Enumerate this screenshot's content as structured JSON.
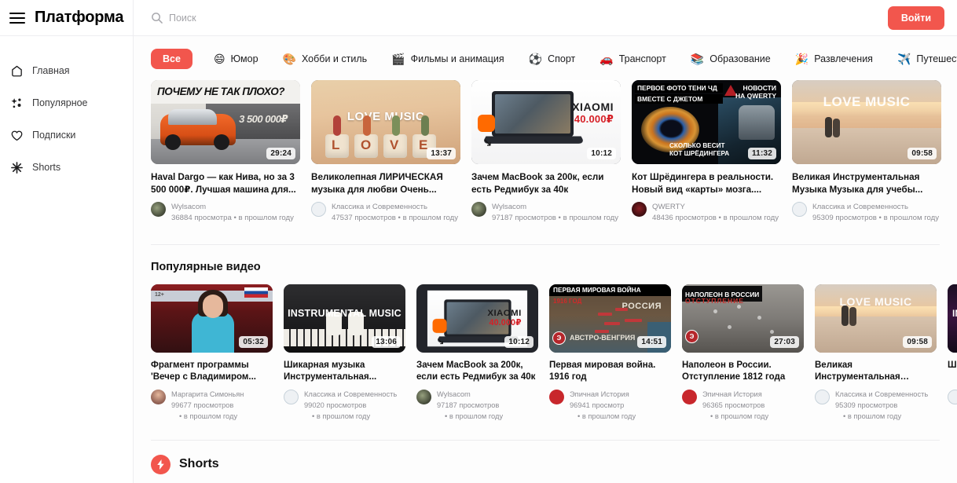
{
  "header": {
    "brand": "Платформа",
    "menu_icon": "hamburger-icon",
    "search_placeholder": "Поиск",
    "search_value": "",
    "search_icon": "search-icon",
    "login_label": "Войти",
    "accent_color": "#f2564d"
  },
  "sidebar": {
    "items": [
      {
        "label": "Главная",
        "icon": "home-icon"
      },
      {
        "label": "Популярное",
        "icon": "sparkle-icon"
      },
      {
        "label": "Подписки",
        "icon": "heart-icon"
      },
      {
        "label": "Shorts",
        "icon": "asterisk-icon"
      }
    ]
  },
  "categories": [
    {
      "label": "Все",
      "emoji": "",
      "active": true
    },
    {
      "label": "Юмор",
      "emoji": "😄",
      "active": false
    },
    {
      "label": "Хобби и стиль",
      "emoji": "🎨",
      "active": false
    },
    {
      "label": "Фильмы и анимация",
      "emoji": "🎬",
      "active": false
    },
    {
      "label": "Спорт",
      "emoji": "⚽",
      "active": false
    },
    {
      "label": "Транспорт",
      "emoji": "🚗",
      "active": false
    },
    {
      "label": "Образование",
      "emoji": "📚",
      "active": false
    },
    {
      "label": "Развлечения",
      "emoji": "🎉",
      "active": false
    },
    {
      "label": "Путешествия",
      "emoji": "✈️",
      "active": false
    }
  ],
  "feed": {
    "videos": [
      {
        "title": "Haval Dargo — как Нива, но за 3 500 000₽. Лучшая машина для...",
        "channel": "Wylsacom",
        "views": "36884 просмотра",
        "when": "в прошлом году",
        "stats": "36884 просмотра • в прошлом году",
        "duration": "29:24",
        "thumb_text": "ПОЧЕМУ НЕ ТАК ПЛОХО?",
        "thumb_price": "3 500 000₽"
      },
      {
        "title": "Великолепная ЛИРИЧЕСКАЯ музыка для любви Очень...",
        "channel": "Классика и Современность",
        "views": "47537 просмотров",
        "when": "в прошлом году",
        "stats": "47537 просмотров • в прошлом году",
        "duration": "13:37",
        "thumb_text": "LOVE MUSIC",
        "thumb_price": ""
      },
      {
        "title": "Зачем MacBook за 200к, если есть Редмибук за 40к",
        "channel": "Wylsacom",
        "views": "97187 просмотров",
        "when": "в прошлом году",
        "stats": "97187 просмотров • в прошлом году",
        "duration": "10:12",
        "thumb_text": "XIAOMI",
        "thumb_price": "40.000₽"
      },
      {
        "title": "Кот Шрёдингера в реальности. Новый вид «карты» мозга....",
        "channel": "QWERTY",
        "views": "48436 просмотров",
        "when": "в прошлом году",
        "stats": "48436 просмотров • в прошлом году",
        "duration": "11:32",
        "thumb_text": "ПЕРВОЕ ФОТО ТЕНИ ЧД",
        "thumb_text2": "ВМЕСТЕ С ДЖЕТОМ",
        "thumb_text3": "НОВОСТИ",
        "thumb_text4": "НА QWERTY",
        "thumb_text5": "СКОЛЬКО ВЕСИТ",
        "thumb_text6": "КОТ ШРЁДИНГЕРА"
      },
      {
        "title": "Великая Инструментальная Музыка Музыка для учебы...",
        "channel": "Классика и Современность",
        "views": "95309 просмотров",
        "when": "в прошлом году",
        "stats": "95309 просмотров • в прошлом году",
        "duration": "09:58",
        "thumb_text": "LOVE MUSIC",
        "thumb_price": ""
      }
    ]
  },
  "popular": {
    "section_title": "Популярные видео",
    "videos": [
      {
        "title": "Фрагмент программы 'Вечер с Владимиром...",
        "channel": "Маргарита Симоньян",
        "views": "99677 просмотров",
        "when": "• в прошлом году",
        "duration": "05:32",
        "thumb_text": "12+"
      },
      {
        "title": "Шикарная музыка Инструментальная...",
        "channel": "Классика и Современность",
        "views": "99020 просмотров",
        "when": "• в прошлом году",
        "duration": "13:06",
        "thumb_text": "INSTRUMENTAL MUSIC"
      },
      {
        "title": "Зачем MacBook за 200к, если есть Редмибук за 40к",
        "channel": "Wylsacom",
        "views": "97187 просмотров",
        "when": "• в прошлом году",
        "duration": "10:12",
        "thumb_text": "XIAOMI",
        "thumb_price": "40.000₽"
      },
      {
        "title": "Первая мировая война. 1916 год",
        "channel": "Эпичная История",
        "views": "96941 просмотр",
        "when": "• в прошлом году",
        "duration": "14:51",
        "thumb_text": "ПЕРВАЯ МИРОВАЯ ВОЙНА",
        "thumb_text2": "1916 ГОД",
        "thumb_text3": "РОССИЯ",
        "thumb_text4": "АВСТРО-ВЕНГРИЯ"
      },
      {
        "title": "Наполеон в России. Отступление 1812 года",
        "channel": "Эпичная История",
        "views": "96365 просмотров",
        "when": "• в прошлом году",
        "duration": "27:03",
        "thumb_text": "НАПОЛЕОН В РОССИИ",
        "thumb_text2": "ОТСТУПЛЕНИЕ"
      },
      {
        "title": "Великая Инструментальная Музыка Музыка для учеб...",
        "channel": "Классика и Современность",
        "views": "95309 просмотров",
        "when": "• в прошлом году",
        "duration": "09:58",
        "thumb_text": "LOVE MUSIC"
      },
      {
        "title": "Шик Инс",
        "channel": "",
        "views": "",
        "when": "",
        "duration": "",
        "thumb_text": "IN"
      }
    ]
  },
  "shorts": {
    "title": "Shorts",
    "icon": "lightning-bolt-icon"
  }
}
